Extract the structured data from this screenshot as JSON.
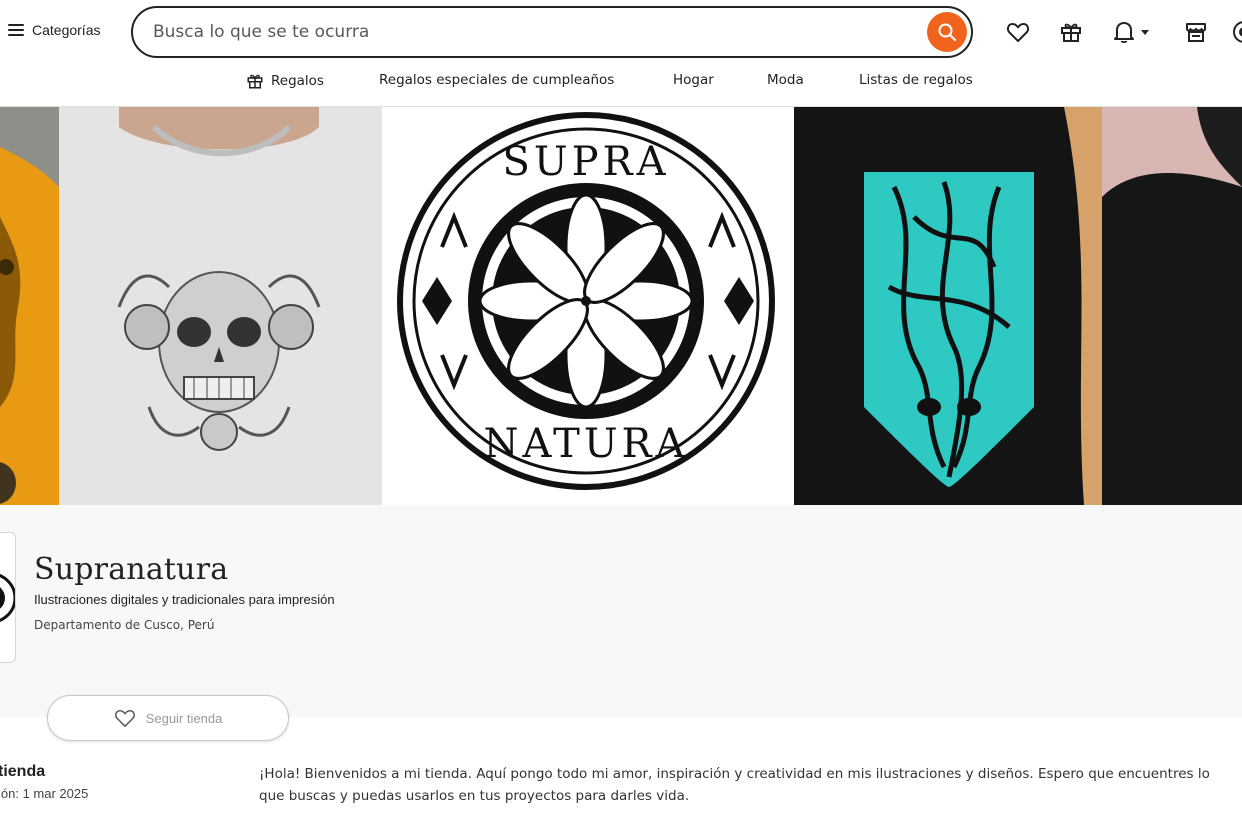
{
  "header": {
    "categories_label": "Categorías",
    "search_placeholder": "Busca lo que se te ocurra"
  },
  "subnav": {
    "items": [
      "Regalos",
      "Regalos especiales de cumpleaños",
      "Hogar",
      "Moda",
      "Listas de regalos"
    ]
  },
  "banner": {
    "logo_top_text": "SUPRA",
    "logo_bottom_text": "NATURA"
  },
  "shop": {
    "name": "Supranatura",
    "tagline": "Ilustraciones digitales y tradicionales para impresión",
    "location": "Departamento de Cusco, Perú",
    "follow_label": "Seguir tienda"
  },
  "about": {
    "title": "tienda",
    "since": "ión: 1 mar 2025",
    "text": "¡Hola! Bienvenidos a mi tienda. Aquí pongo todo mi amor, inspiración y creatividad en mis ilustraciones y diseños. Espero que encuentres lo que buscas y puedas usarlos en tus proyectos para darles vida."
  },
  "colors": {
    "accent": "#f1641e",
    "teal_print": "#2fc9c4",
    "info_bg": "#f8f8f8"
  }
}
